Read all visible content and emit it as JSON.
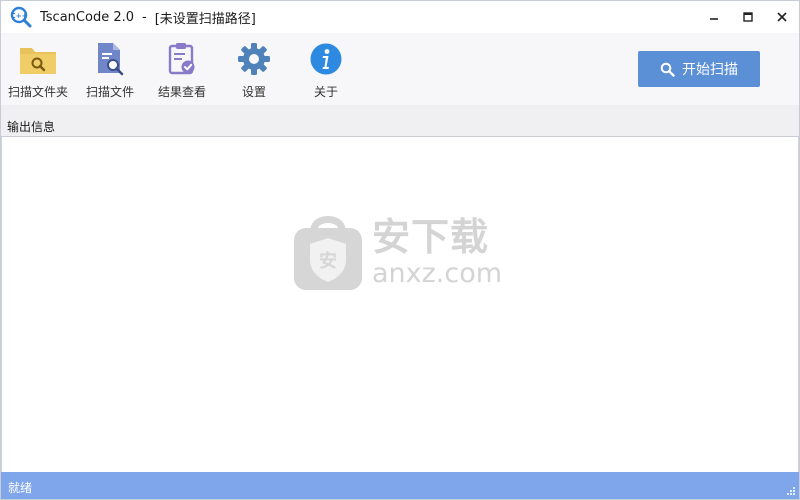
{
  "window": {
    "app_name": "TscanCode 2.0",
    "separator": "-",
    "path_status": "[未设置扫描路径]"
  },
  "toolbar": {
    "items": [
      {
        "label": "扫描文件夹",
        "icon": "folder-search-icon"
      },
      {
        "label": "扫描文件",
        "icon": "file-search-icon"
      },
      {
        "label": "结果查看",
        "icon": "clipboard-check-icon"
      },
      {
        "label": "设置",
        "icon": "gear-icon"
      },
      {
        "label": "关于",
        "icon": "info-icon"
      }
    ],
    "scan_button": {
      "label": "开始扫描",
      "icon": "search-icon"
    }
  },
  "output": {
    "header": "输出信息"
  },
  "watermark": {
    "badge_char": "安",
    "cn": "安下载",
    "en": "anxz.com"
  },
  "statusbar": {
    "text": "就绪"
  },
  "colors": {
    "accent": "#5b8fd6",
    "statusbar": "#7fa6ea",
    "folder": "#e8c25a",
    "file": "#6f87c9",
    "clipboard": "#8a7bc8",
    "gear": "#4f82b9",
    "info": "#2e8ae0"
  }
}
